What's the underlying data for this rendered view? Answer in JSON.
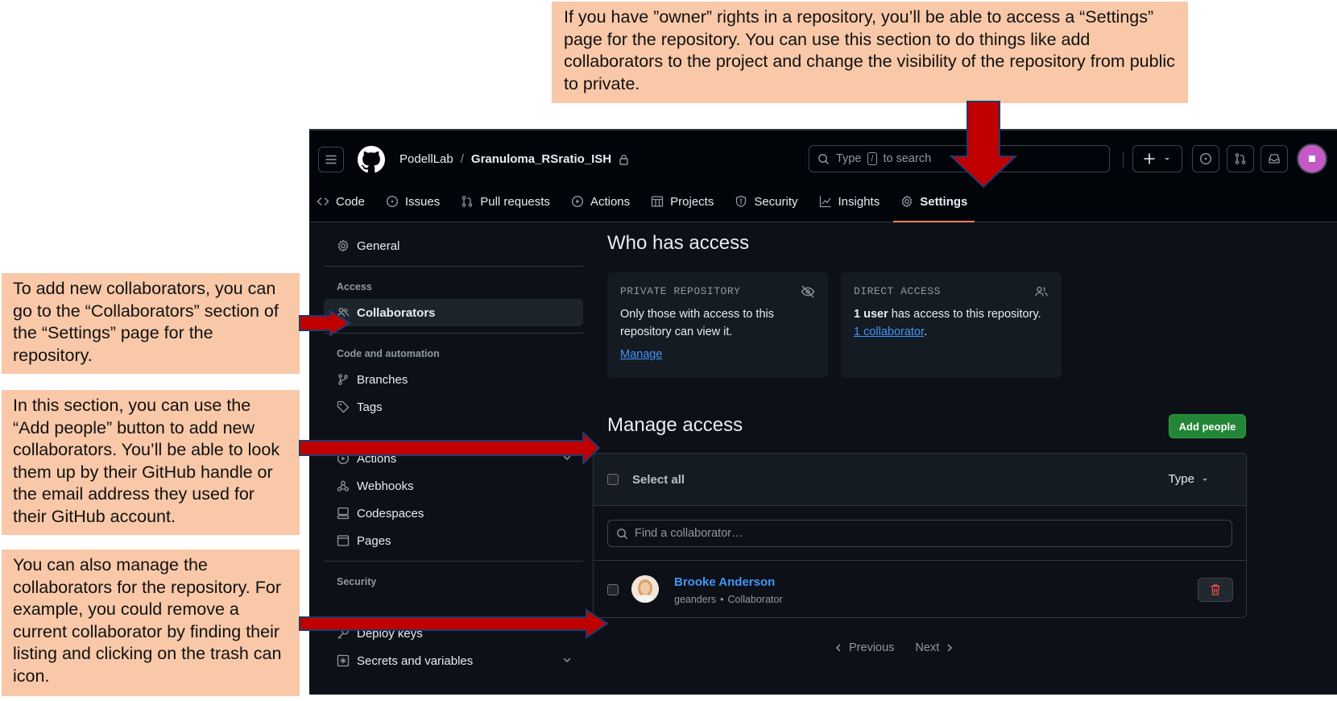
{
  "callouts": {
    "top": "If you have ”owner” rights in a repository, you’ll be able to access a “Settings” page for the repository. You can use this section to do things like add collaborators to the project and change the visibility of the repository from public to private.",
    "collaborators": "To add new collaborators, you can go to the “Collaborators” section of the “Settings” page for the repository.",
    "add_people": "In this section, you can use the “Add people” button to add new collaborators. You’ll be able to look them up by their GitHub handle or the email address they used for their GitHub account.",
    "manage": "You can also manage the collaborators for the repository. For example, you could remove a current collaborator by finding their listing and clicking on the trash can icon."
  },
  "header": {
    "owner": "PodellLab",
    "separator": "/",
    "repo": "Granuloma_RSratio_ISH",
    "search_prefix": "Type",
    "search_key": "/",
    "search_suffix": "to search"
  },
  "tabs": [
    {
      "label": "Code",
      "icon": "code-icon"
    },
    {
      "label": "Issues",
      "icon": "issue-icon"
    },
    {
      "label": "Pull requests",
      "icon": "pull-request-icon"
    },
    {
      "label": "Actions",
      "icon": "play-icon"
    },
    {
      "label": "Projects",
      "icon": "table-icon"
    },
    {
      "label": "Security",
      "icon": "shield-icon"
    },
    {
      "label": "Insights",
      "icon": "graph-icon"
    },
    {
      "label": "Settings",
      "icon": "gear-icon",
      "active": true
    }
  ],
  "sidebar": {
    "general": "General",
    "access_heading": "Access",
    "collaborators": "Collaborators",
    "code_heading": "Code and automation",
    "branches": "Branches",
    "tags": "Tags",
    "actions": "Actions",
    "webhooks": "Webhooks",
    "codespaces": "Codespaces",
    "pages": "Pages",
    "security_heading": "Security",
    "deploy_keys": "Deploy keys",
    "secrets": "Secrets and variables"
  },
  "main": {
    "who_title": "Who has access",
    "private_label": "PRIVATE REPOSITORY",
    "private_text": "Only those with access to this repository can view it.",
    "manage_link": "Manage",
    "direct_label": "DIRECT ACCESS",
    "direct_bold": "1 user",
    "direct_text": " has access to this repository. ",
    "direct_link": "1 collaborator",
    "direct_end": ".",
    "manage_title": "Manage access",
    "add_people": "Add people",
    "select_all": "Select all",
    "type_filter": "Type",
    "find_placeholder": "Find a collaborator…",
    "collaborator": {
      "name": "Brooke Anderson",
      "handle": "geanders",
      "dot": "•",
      "role": "Collaborator"
    },
    "previous": "Previous",
    "next": "Next"
  },
  "colors": {
    "callout_bg": "#f8c8a8",
    "arrow_red": "#c00000",
    "gh_bg": "#0d1117",
    "green": "#238636",
    "link": "#4493f8"
  }
}
